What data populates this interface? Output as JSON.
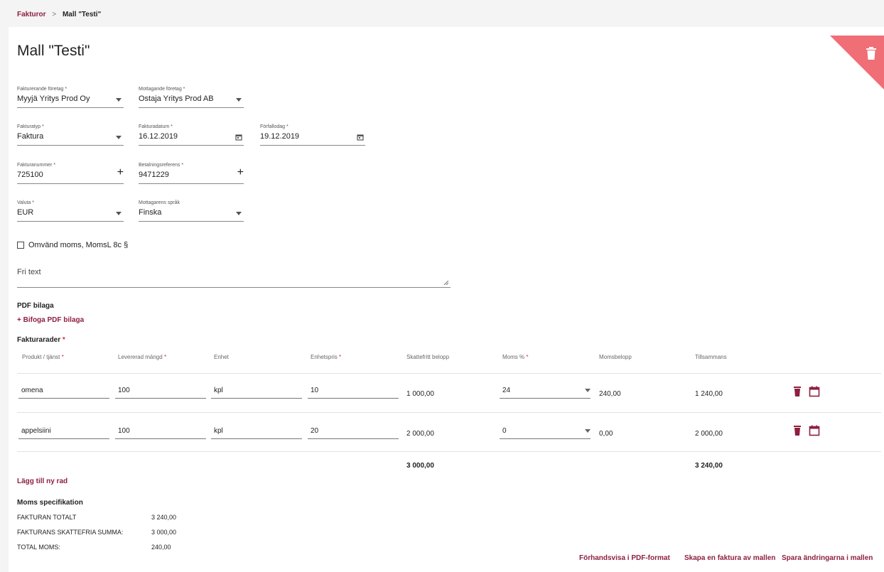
{
  "breadcrumb": {
    "parent": "Fakturor",
    "separator": ">",
    "current": "Mall \"Testi\""
  },
  "page": {
    "title": "Mall \"Testi\""
  },
  "colors": {
    "accent": "#8e1f3f",
    "delete_corner": "#f06e76"
  },
  "form": {
    "billing_company": {
      "label": "Fakturerande företag *",
      "value": "Myyjä Yritys Prod Oy"
    },
    "receiving_company": {
      "label": "Mottagande företag *",
      "value": "Ostaja Yritys Prod AB"
    },
    "invoice_type": {
      "label": "Fakturatyp *",
      "value": "Faktura"
    },
    "invoice_date": {
      "label": "Fakturadatum *",
      "value": "16.12.2019"
    },
    "due_date": {
      "label": "Förfallodag *",
      "value": "19.12.2019"
    },
    "invoice_number": {
      "label": "Fakturanummer *",
      "value": "725100"
    },
    "payment_reference": {
      "label": "Betalningsreferens *",
      "value": "9471229"
    },
    "currency": {
      "label": "Valuta *",
      "value": "EUR"
    },
    "recipient_language": {
      "label": "Mottagarens språk",
      "value": "Finska"
    },
    "reverse_vat": {
      "label": "Omvänd moms, MomsL 8c §",
      "checked": false
    },
    "free_text": {
      "label": "Fri text",
      "value": ""
    }
  },
  "pdf": {
    "title": "PDF bilaga",
    "attach_link": "+ Bifoga PDF bilaga"
  },
  "rows_section": {
    "title": "Fakturarader",
    "required_mark": "*",
    "headers": {
      "product": "Produkt / tjänst",
      "quantity": "Levererad mängd",
      "unit": "Enhet",
      "unit_price": "Enhetspris",
      "tax_free": "Skattefritt belopp",
      "vat_pct": "Moms %",
      "vat_amount": "Momsbelopp",
      "total": "Tillsammans"
    },
    "rows": [
      {
        "product": "omena",
        "quantity": "100",
        "unit": "kpl",
        "unit_price": "10",
        "tax_free": "1 000,00",
        "vat_pct": "24",
        "vat_amount": "240,00",
        "total": "1 240,00"
      },
      {
        "product": "appelsiini",
        "quantity": "100",
        "unit": "kpl",
        "unit_price": "20",
        "tax_free": "2 000,00",
        "vat_pct": "0",
        "vat_amount": "0,00",
        "total": "2 000,00"
      }
    ],
    "sum_tax_free": "3 000,00",
    "sum_total": "3 240,00",
    "add_row": "Lägg till ny rad"
  },
  "vat_spec": {
    "title": "Moms specifikation",
    "lines": [
      {
        "label": "FAKTURAN TOTALT",
        "value": "3 240,00"
      },
      {
        "label": "FAKTURANS SKATTEFRIA SUMMA:",
        "value": "3 000,00"
      },
      {
        "label": "TOTAL MOMS:",
        "value": "240,00"
      }
    ]
  },
  "actions": {
    "preview_pdf": "Förhandsvisa i PDF-format",
    "create_invoice": "Skapa en faktura av mallen",
    "save_template": "Spara ändringarna i mallen"
  }
}
